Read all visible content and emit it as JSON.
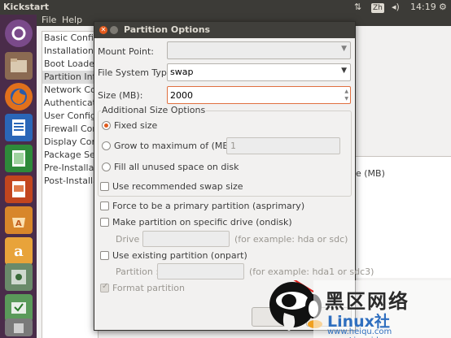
{
  "top_panel": {
    "title": "Kickstart",
    "lang": "Zh",
    "time": "14:19"
  },
  "menubar": {
    "file": "File",
    "help": "Help"
  },
  "nav": {
    "items": [
      "Basic Configu",
      "Installation M",
      "Boot Loader",
      "Partition Info",
      "Network Con",
      "Authenticatio",
      "User Configu",
      "Firewall Conf",
      "Display Confi",
      "Package Sele",
      "Pre-Installatio",
      "Post-Installati"
    ],
    "selected_index": 3
  },
  "right_panel": {
    "header": "e (MB)"
  },
  "dialog": {
    "title": "Partition Options",
    "mount_point": {
      "label": "Mount Point:",
      "value": ""
    },
    "fs_type": {
      "label": "File System Type:",
      "value": "swap"
    },
    "size": {
      "label": "Size (MB):",
      "value": "2000"
    },
    "additional": {
      "title": "Additional Size Options",
      "fixed": "Fixed size",
      "grow": "Grow to maximum of (MB):",
      "grow_value": "1",
      "fill": "Fill all unused space on disk",
      "recommended": "Use recommended swap size"
    },
    "force_primary": "Force to be a primary partition (asprimary)",
    "specific_drive": "Make partition on specific drive (ondisk)",
    "drive_label": "Drive :",
    "drive_hint": "(for example: hda or sdc)",
    "existing": "Use existing partition (onpart)",
    "partition_label": "Partition :",
    "partition_hint": "(for example: hda1 or sdc3)",
    "format": "Format partition"
  },
  "watermark": {
    "line1": "黑区网络",
    "line2": "Linux社",
    "url": "www.heiqu.com www.Linuxidc.com"
  }
}
